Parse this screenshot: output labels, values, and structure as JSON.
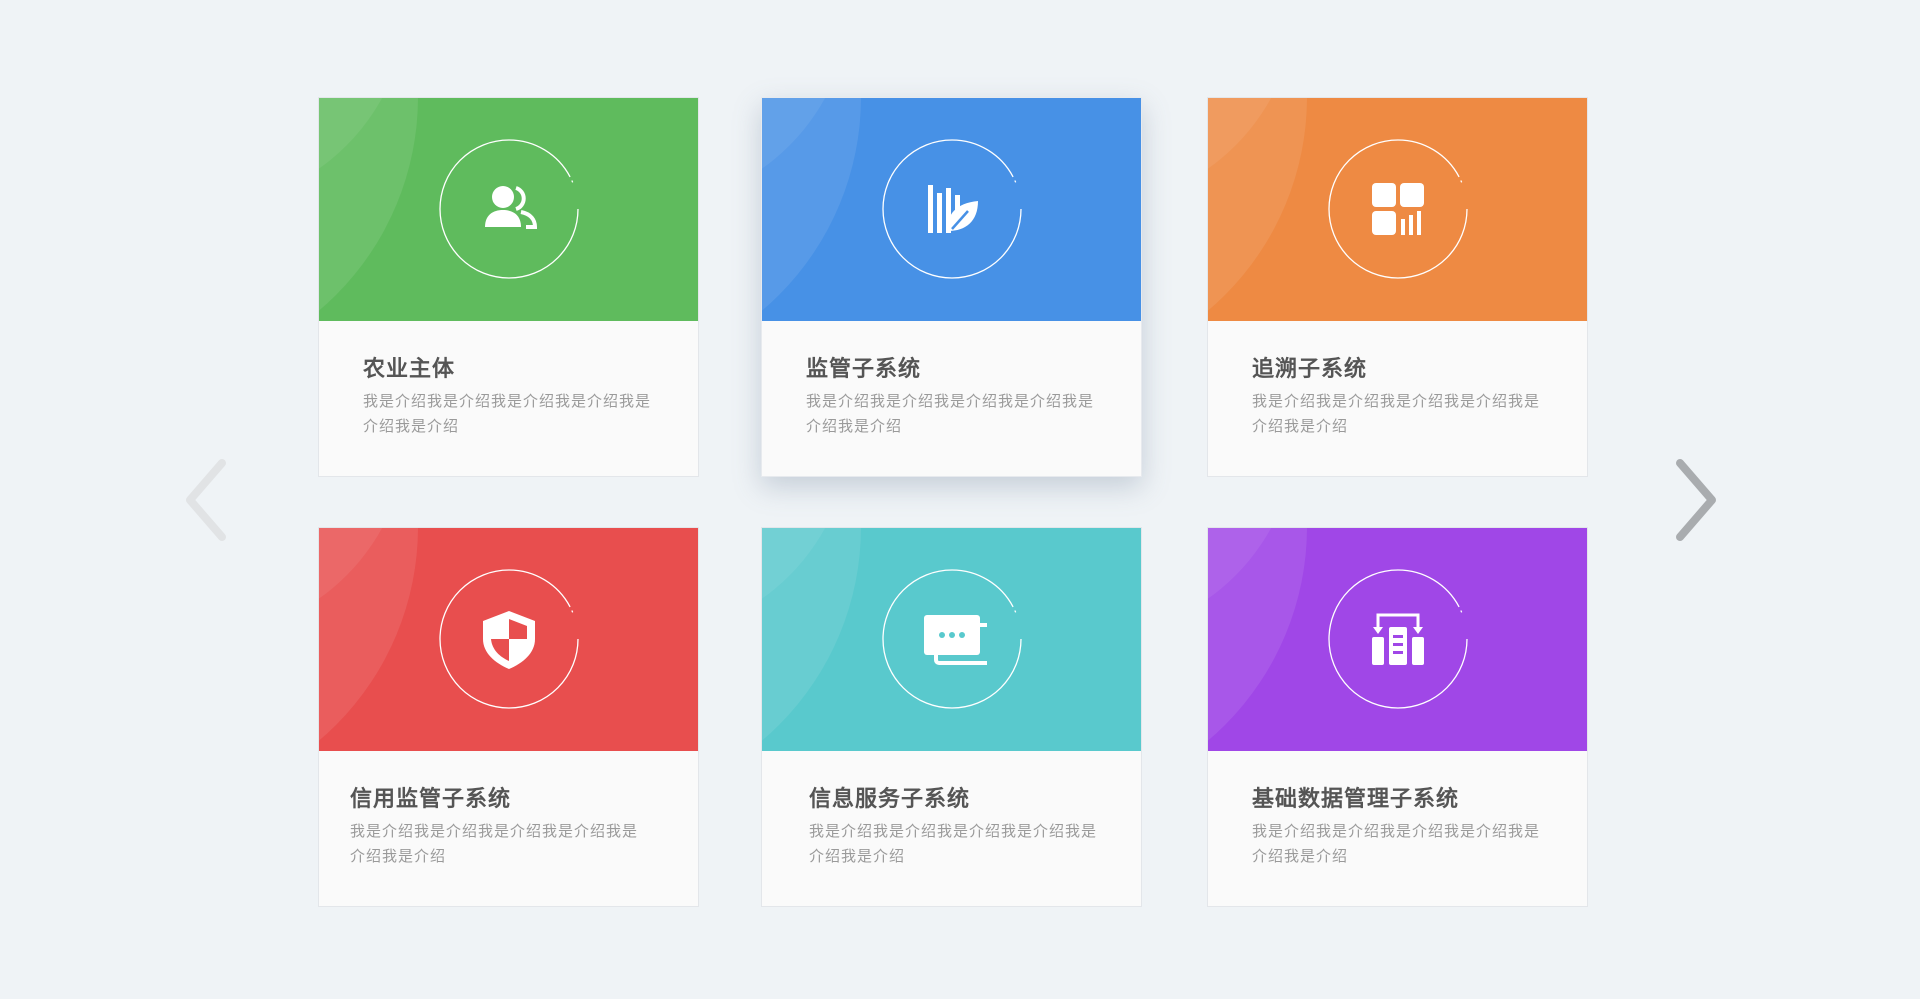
{
  "cards": [
    {
      "title": "农业主体",
      "desc": "我是介绍我是介绍我是介绍我是介绍我是介绍我是介绍",
      "color": "#5fbb5d",
      "icon": "users-icon"
    },
    {
      "title": "监管子系统",
      "desc": "我是介绍我是介绍我是介绍我是介绍我是介绍我是介绍",
      "color": "#4791e6",
      "icon": "bar-chart-leaf-icon"
    },
    {
      "title": "追溯子系统",
      "desc": "我是介绍我是介绍我是介绍我是介绍我是介绍我是介绍",
      "color": "#ee8a43",
      "icon": "dashboard-grid-icon"
    },
    {
      "title": "信用监管子系统",
      "desc": "我是介绍我是介绍我是介绍我是介绍我是介绍我是介绍",
      "color": "#e84e4e",
      "icon": "shield-icon"
    },
    {
      "title": "信息服务子系统",
      "desc": "我是介绍我是介绍我是介绍我是介绍我是介绍我是介绍",
      "color": "#59c9cd",
      "icon": "message-cards-icon"
    },
    {
      "title": "基础数据管理子系统",
      "desc": "我是介绍我是介绍我是介绍我是介绍我是介绍我是介绍",
      "color": "#a047e7",
      "icon": "data-transfer-icon"
    }
  ],
  "nav": {
    "prev_icon": "chevron-left-icon",
    "next_icon": "chevron-right-icon"
  },
  "colors": {
    "background": "#eff3f6",
    "prev_arrow": "#e1e3e5",
    "next_arrow": "#a9acaf"
  }
}
